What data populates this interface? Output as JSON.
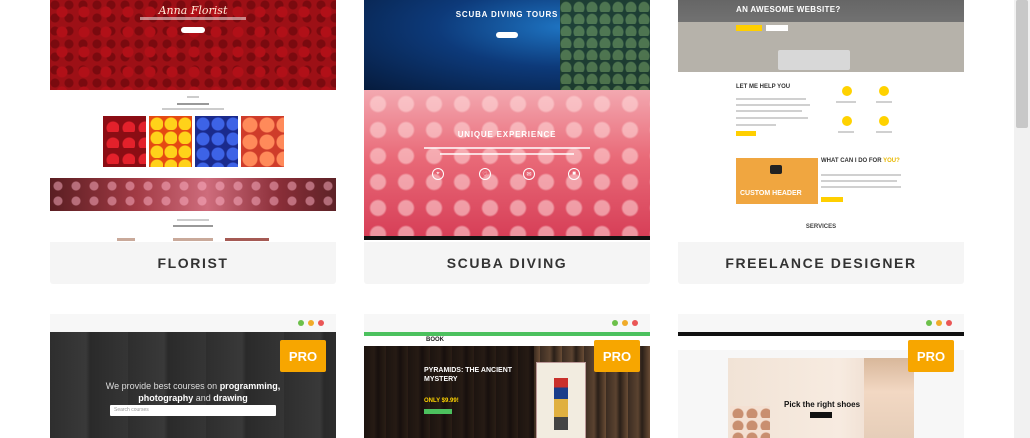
{
  "templates": [
    {
      "name": "FLORIST",
      "hero_title": "Anna Florist",
      "section_label": "WHAT WE OFFER"
    },
    {
      "name": "SCUBA DIVING",
      "hero_title": "SCUBA DIVING TOURS",
      "section_title": "UNIQUE EXPERIENCE"
    },
    {
      "name": "FREELANCE DESIGNER",
      "hero_title": "AN AWESOME WEBSITE?",
      "help_title": "LET ME HELP YOU",
      "what_title_prefix": "WHAT CAN I DO FOR ",
      "what_title_accent": "YOU?",
      "video_title": "CUSTOM HEADER",
      "services_title": "SERVICES"
    }
  ],
  "pro_templates": [
    {
      "badge": "PRO",
      "headline_pre": "We provide best courses on ",
      "headline_b1": "programming,",
      "headline_b2": "photography",
      "headline_mid": " and ",
      "headline_b3": "drawing",
      "search_placeholder": "Search courses"
    },
    {
      "badge": "PRO",
      "logo": "BOOK",
      "hero_title": "PYRAMIDS: THE ANCIENT MYSTERY",
      "price": "ONLY $9.99!"
    },
    {
      "badge": "PRO",
      "hero_title": "Pick the right shoes"
    }
  ],
  "colors": {
    "pro_badge": "#f7a600",
    "dot_green": "#6cc04a",
    "dot_yellow": "#f0ac2a",
    "dot_red": "#ea5656"
  }
}
